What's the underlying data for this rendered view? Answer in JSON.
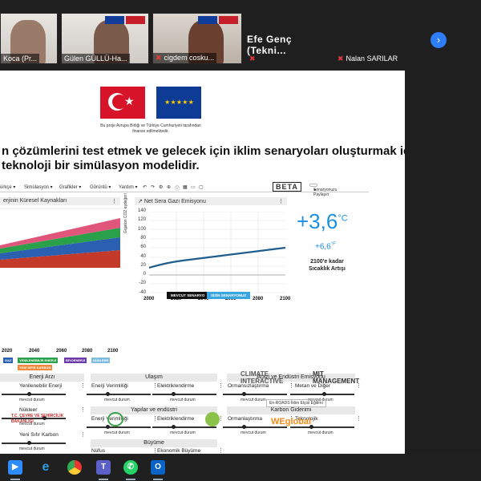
{
  "meeting": {
    "participants": [
      {
        "name": "Koca (Pr..."
      },
      {
        "name": "Gülen GÜLLÜ-Ha..."
      },
      {
        "name": "cigdem cosku..."
      },
      {
        "name": "Efe Genç (Tekni..."
      },
      {
        "name": "Nalan SARILAR"
      }
    ],
    "next_icon": "chevron-right-icon"
  },
  "slide": {
    "funding_text": "Bu proje Avrupa Birliği ve Türkiye Cumhuriyeti tarafından finanse edilmektedir.",
    "headline_line1": "n çözümlerini test etmek ve gelecek için iklim senaryoları oluşturmak için",
    "headline_line2": "teknoloji bir simülasyon modelidir.",
    "toolbar": {
      "menu1": "ürkçe ▾",
      "menu2": "Simülasyon ▾",
      "menu3": "Grafikler ▾",
      "menu4": "Görüntü ▾",
      "menu5": "Yardım ▾",
      "beta": "BETA",
      "scenario_button": "Senaryonuzu Paylaşın"
    },
    "left_chart": {
      "title": "erjinin Küresel Kaynakları",
      "x_ticks": [
        "2020",
        "2040",
        "2060",
        "2080",
        "2100"
      ],
      "legend": [
        "GAZ",
        "YENİLENEBİLİR ENERJİ",
        "BİYOENERJİ",
        "NÜKLEER",
        "YENİ SIFIR KARBON"
      ]
    },
    "right_chart": {
      "title": "Net Sera Gazı Emisyonu",
      "ylabel": "Gigaton CO2 eşdeğeri",
      "y_ticks": [
        "140",
        "120",
        "100",
        "80",
        "60",
        "40",
        "20",
        "0",
        "-20",
        "-40"
      ],
      "x_ticks": [
        "2000",
        "2020",
        "2040",
        "2060",
        "2080",
        "2100"
      ],
      "btn_current": "MEVCUT SENARYO",
      "btn_yours": "SİZİN SENARYONUZ"
    },
    "temperature": {
      "value": "+3,6",
      "unit": "°C",
      "small_value": "+6,6",
      "small_unit": "°F",
      "caption": "2100'e kadar Sıcaklık Artışı"
    },
    "sections": {
      "energy": "Enerji Arzı",
      "transport": "Ulaşım",
      "land": "Arazi ve Endüstri Emisyonu",
      "buildings": "Yapılar ve endüstri",
      "removal": "Karbon Giderimi",
      "growth": "Büyüme"
    },
    "controls": {
      "c1": "Yenilenebilir Enerji",
      "c2": "Nükleer",
      "c3": "Yeni Sıfır Karbon",
      "c4": "Karbon Fiyatı",
      "c5": "Enerji Verimliliği",
      "c6": "Elektriklendirme",
      "c7": "Enerji Verimliliği",
      "c8": "Elektriklendirme",
      "c9": "Nüfus",
      "c10": "Ekonomik Büyüme",
      "c11": "Ormansızlaştırma",
      "c12": "Metan ve Diğer",
      "c13": "Ormanlaştırma",
      "c14": "Teknolojik",
      "status": "mevcut durum"
    },
    "brands": {
      "climate": "CLIMATE INTERACTIVE",
      "mit": "MIT MANAGEMENT",
      "en_roads": "En-ROADS İklim Elçisi Eğitimi",
      "ministry": "T.C. ÇEVRE VE ŞEHİRCİLİK BAKANLIĞI",
      "weglobal": "WEglobal"
    }
  },
  "taskbar": {
    "apps": [
      "zoom-icon",
      "edge-icon",
      "chrome-icon",
      "teams-icon",
      "whatsapp-icon",
      "outlook-icon"
    ]
  },
  "colors": {
    "temperature": "#1b8fe0",
    "emission_line": "#1f5e8c",
    "accent": "#2e7cf6"
  }
}
